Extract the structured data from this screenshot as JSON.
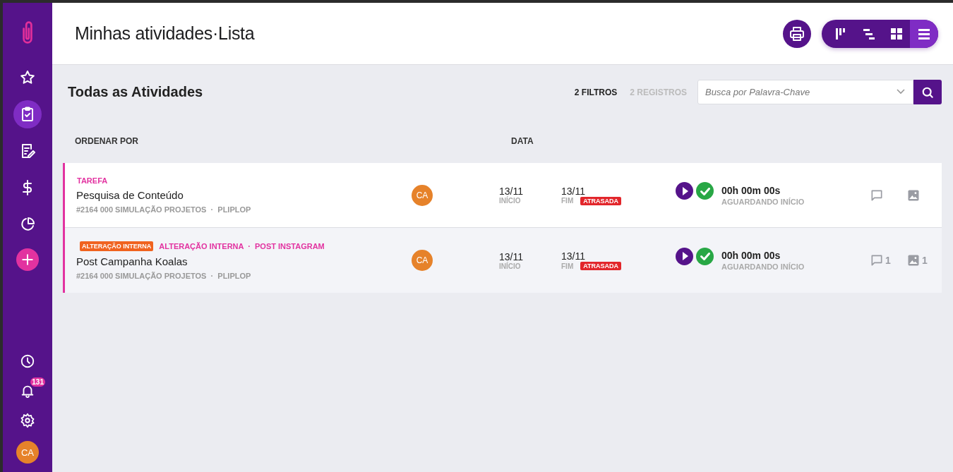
{
  "header": {
    "title": "Minhas atividades·Lista"
  },
  "sidebar": {
    "items": [
      {
        "selected": false
      },
      {
        "selected": true
      },
      {
        "selected": false
      },
      {
        "selected": false
      },
      {
        "selected": false
      }
    ],
    "notification_badge": "131",
    "avatar": "CA"
  },
  "view_modes": [
    {
      "selected": false
    },
    {
      "selected": false
    },
    {
      "selected": false
    },
    {
      "selected": true
    }
  ],
  "section": {
    "title": "Todas as Atividades",
    "filters": "2 FILTROS",
    "records": "2 REGISTROS",
    "search": {
      "placeholder": "Busca por Palavra-Chave"
    }
  },
  "columns": [
    "ORDENAR POR",
    "DATA"
  ],
  "rows": [
    {
      "tags": [
        {
          "kind": "text",
          "text": "TAREFA"
        }
      ],
      "title": "Pesquisa de Conteúdo",
      "meta": "#2164 000 SIMULAÇÃO PROJETOS  ·  PLIPLOP",
      "avatar": "CA",
      "start": "13/11",
      "start_label": "INÍCIO",
      "end": "13/11",
      "end_label": "FIM",
      "status": "ATRASADA",
      "timer": "00h 00m 00s",
      "timer_label": "AGUARDANDO INÍCIO"
    },
    {
      "tags": [
        {
          "kind": "badge",
          "text": "ALTERAÇÃO INTERNA"
        },
        {
          "kind": "text",
          "text": "ALTERAÇÃO INTERNA  ·  POST INSTAGRAM"
        }
      ],
      "title": "Post Campanha Koalas",
      "meta": "#2164 000 SIMULAÇÃO PROJETOS  ·  PLIPLOP",
      "avatar": "CA",
      "start": "13/11",
      "start_label": "INÍCIO",
      "end": "13/11",
      "end_label": "FIM",
      "status": "ATRASADA",
      "timer": "00h 00m 00s",
      "timer_label": "AGUARDANDO INÍCIO",
      "comments": "1",
      "images": "1"
    }
  ]
}
